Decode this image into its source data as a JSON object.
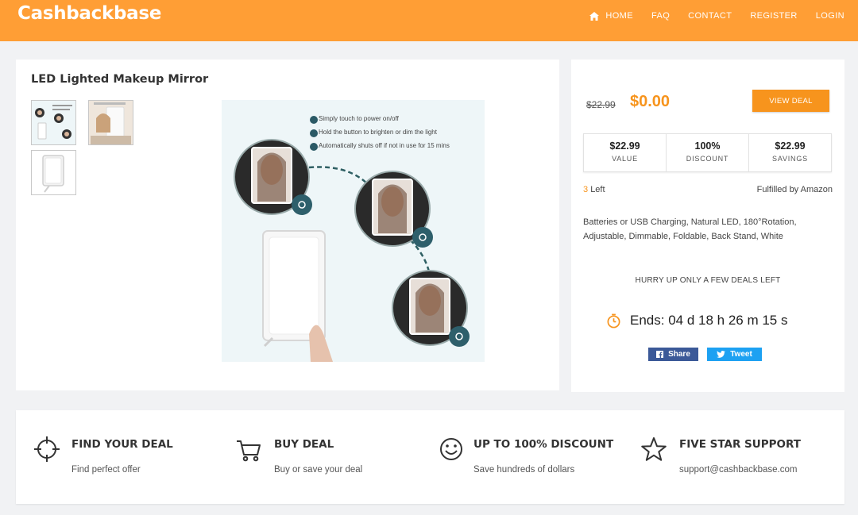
{
  "header": {
    "logo": "Cashbackbase",
    "nav": [
      {
        "label": "HOME",
        "icon": "home-icon"
      },
      {
        "label": "FAQ"
      },
      {
        "label": "CONTACT"
      },
      {
        "label": "REGISTER"
      },
      {
        "label": "LOGIN"
      }
    ]
  },
  "product": {
    "title": "LED Lighted Makeup Mirror",
    "image_features": [
      "Simply touch to power on/off",
      "Hold the button to brighten or dim the light",
      "Automatically shuts off if not in use for 15 mins"
    ]
  },
  "deal": {
    "old_price": "$22.99",
    "new_price": "$0.00",
    "view_deal_label": "VIEW DEAL",
    "stats": [
      {
        "value": "$22.99",
        "label": "VALUE"
      },
      {
        "value": "100%",
        "label": "DISCOUNT"
      },
      {
        "value": "$22.99",
        "label": "SAVINGS"
      }
    ],
    "left_count": "3",
    "left_label": "Left",
    "fulfilled": "Fulfilled by Amazon",
    "description": "Batteries or USB Charging, Natural LED, 180°Rotation, Adjustable, Dimmable, Foldable, Back Stand, White",
    "hurry": "HURRY UP ONLY A FEW DEALS LEFT",
    "timer": "Ends: 04 d 18 h 26 m 15 s",
    "share_label": "Share",
    "tweet_label": "Tweet"
  },
  "features": [
    {
      "icon": "crosshair-icon",
      "title": "FIND YOUR DEAL",
      "desc": "Find perfect offer"
    },
    {
      "icon": "cart-icon",
      "title": "BUY DEAL",
      "desc": "Buy or save your deal"
    },
    {
      "icon": "smile-icon",
      "title": "UP TO 100% DISCOUNT",
      "desc": "Save hundreds of dollars"
    },
    {
      "icon": "star-icon",
      "title": "FIVE STAR SUPPORT",
      "desc": "support@cashbackbase.com"
    }
  ],
  "colors": {
    "header_bg": "#ff9e35",
    "accent": "#f7941d",
    "facebook": "#3b5998",
    "twitter": "#1da1f2"
  }
}
